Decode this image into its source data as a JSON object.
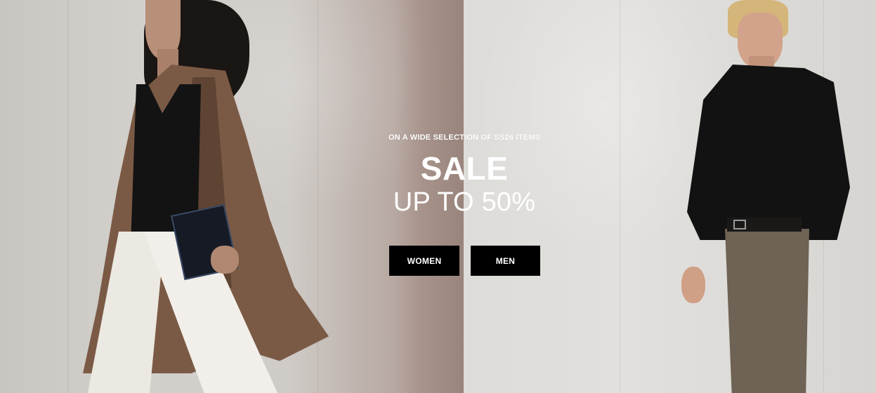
{
  "promo": {
    "eyebrow": "ON A WIDE SELECTION OF SS26 ITEMS",
    "headline": "SALE",
    "subhead": "UP TO 50%"
  },
  "buttons": {
    "women_label": "WOMEN",
    "men_label": "MEN"
  },
  "colors": {
    "button_bg": "#000000",
    "button_text": "#ffffff",
    "headline_text": "#ffffff"
  }
}
